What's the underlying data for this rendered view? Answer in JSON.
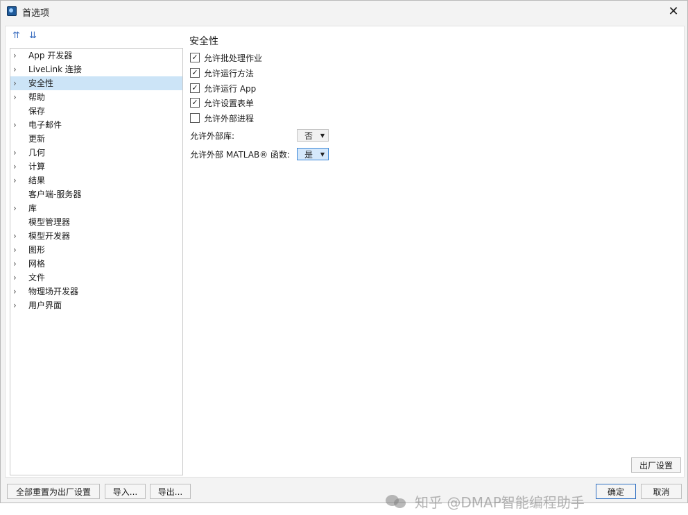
{
  "window": {
    "title": "首选项",
    "close_glyph": "✕"
  },
  "toolbar": {
    "expand_glyph": "⇈",
    "collapse_glyph": "⇊"
  },
  "tree": {
    "items": [
      {
        "label": "App 开发器",
        "expandable": true
      },
      {
        "label": "LiveLink 连接",
        "expandable": true
      },
      {
        "label": "安全性",
        "expandable": true,
        "selected": true
      },
      {
        "label": "帮助",
        "expandable": true
      },
      {
        "label": "保存",
        "expandable": false
      },
      {
        "label": "电子邮件",
        "expandable": true
      },
      {
        "label": "更新",
        "expandable": false
      },
      {
        "label": "几何",
        "expandable": true
      },
      {
        "label": "计算",
        "expandable": true
      },
      {
        "label": "结果",
        "expandable": true
      },
      {
        "label": "客户端-服务器",
        "expandable": false
      },
      {
        "label": "库",
        "expandable": true
      },
      {
        "label": "模型管理器",
        "expandable": false
      },
      {
        "label": "模型开发器",
        "expandable": true
      },
      {
        "label": "图形",
        "expandable": true
      },
      {
        "label": "网格",
        "expandable": true
      },
      {
        "label": "文件",
        "expandable": true
      },
      {
        "label": "物理场开发器",
        "expandable": true
      },
      {
        "label": "用户界面",
        "expandable": true
      }
    ],
    "chevron_glyph": "›"
  },
  "security": {
    "title": "安全性",
    "checkboxes": [
      {
        "label": "允许批处理作业",
        "checked": true
      },
      {
        "label": "允许运行方法",
        "checked": true
      },
      {
        "label": "允许运行 App",
        "checked": true
      },
      {
        "label": "允许设置表单",
        "checked": true
      },
      {
        "label": "允许外部进程",
        "checked": false
      }
    ],
    "selects": [
      {
        "label": "允许外部库:",
        "value": "否"
      },
      {
        "label": "允许外部 MATLAB® 函数:",
        "value": "是"
      }
    ],
    "check_glyph": "✓",
    "dropdown_arrow": "▼"
  },
  "buttons": {
    "factory_reset": "出厂设置",
    "reset_all": "全部重置为出厂设置",
    "import": "导入...",
    "export": "导出...",
    "ok": "确定",
    "cancel": "取消"
  },
  "watermark": {
    "text": "知乎 @DMAP智能编程助手"
  }
}
